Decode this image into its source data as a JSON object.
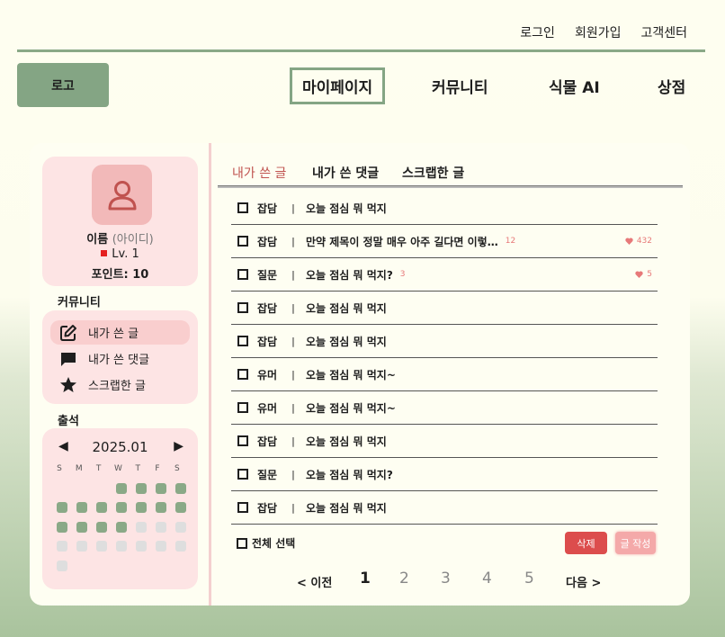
{
  "top_links": [
    "로그인",
    "회원가입",
    "고객센터"
  ],
  "logo": "로고",
  "main_nav": [
    "마이페이지",
    "커뮤니티",
    "식물 AI",
    "상점"
  ],
  "profile": {
    "name": "이름",
    "id": "(아이디)",
    "level": "Lv. 1",
    "points": "포인트: 10"
  },
  "community_title": "커뮤니티",
  "menu": [
    "내가 쓴 글",
    "내가 쓴 댓글",
    "스크랩한 글"
  ],
  "attendance_title": "출석",
  "calendar": {
    "month": "2025.01",
    "prev": "◀",
    "next": "▶",
    "weekdays": [
      "S",
      "M",
      "T",
      "W",
      "T",
      "F",
      "S"
    ],
    "attended_days": 15,
    "unattended_days": 11,
    "first_weekday": 3,
    "colors": {
      "attended": "#8aa987",
      "unattended": "#dedede"
    }
  },
  "tabs": [
    "내가 쓴 글",
    "내가 쓴 댓글",
    "스크랩한 글"
  ],
  "posts": [
    {
      "cat": "잡담",
      "title": "오늘 점심 뭐 먹지",
      "comments": "",
      "likes": ""
    },
    {
      "cat": "잡담",
      "title": "만약 제목이 정말 매우 아주 길다면 이렇…",
      "comments": "12",
      "likes": "432"
    },
    {
      "cat": "질문",
      "title": "오늘 점심 뭐 먹지?",
      "comments": "3",
      "likes": "5"
    },
    {
      "cat": "잡담",
      "title": "오늘 점심 뭐 먹지",
      "comments": "",
      "likes": ""
    },
    {
      "cat": "잡담",
      "title": "오늘 점심 뭐 먹지",
      "comments": "",
      "likes": ""
    },
    {
      "cat": "유머",
      "title": "오늘 점심 뭐 먹지~",
      "comments": "",
      "likes": ""
    },
    {
      "cat": "유머",
      "title": "오늘 점심 뭐 먹지~",
      "comments": "",
      "likes": ""
    },
    {
      "cat": "잡담",
      "title": "오늘 점심 뭐 먹지",
      "comments": "",
      "likes": ""
    },
    {
      "cat": "질문",
      "title": "오늘 점심 뭐 먹지?",
      "comments": "",
      "likes": ""
    },
    {
      "cat": "잡담",
      "title": "오늘 점심 뭐 먹지",
      "comments": "",
      "likes": ""
    }
  ],
  "separator": "|",
  "select_all": "전체 선택",
  "delete_btn": "삭제",
  "write_btn": "글 작성",
  "pager": {
    "prev": "< 이전",
    "pages": [
      "1",
      "2",
      "3",
      "4",
      "5"
    ],
    "current": "1",
    "next": "다음 >"
  },
  "colors": {
    "brand": "#84a584",
    "accent": "#dc4d4d",
    "pink": "#fde4e4"
  }
}
